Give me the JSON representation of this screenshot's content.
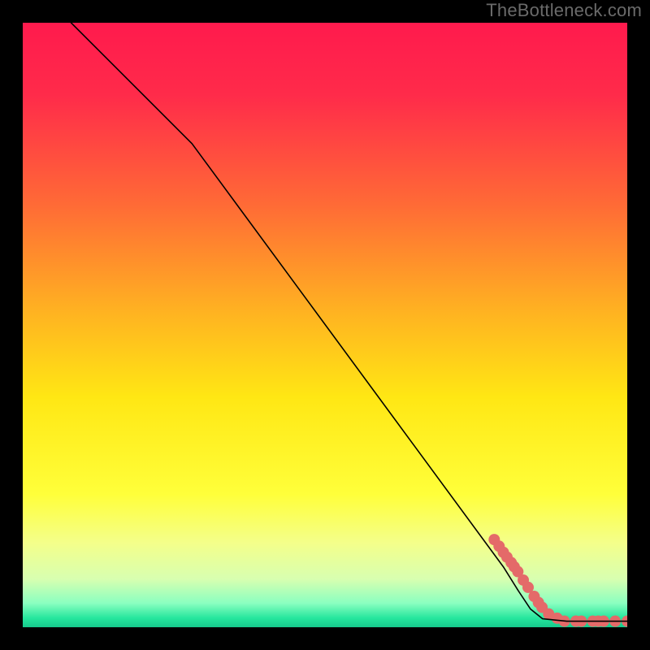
{
  "watermark": "TheBottleneck.com",
  "chart_data": {
    "type": "line",
    "title": "",
    "xlabel": "",
    "ylabel": "",
    "xlim": [
      0,
      100
    ],
    "ylim": [
      0,
      100
    ],
    "grid": false,
    "legend": false,
    "background_gradient": {
      "stops": [
        {
          "pos": 0.0,
          "color": "#ff1a4d"
        },
        {
          "pos": 0.12,
          "color": "#ff2b4a"
        },
        {
          "pos": 0.3,
          "color": "#ff6a36"
        },
        {
          "pos": 0.48,
          "color": "#ffb321"
        },
        {
          "pos": 0.62,
          "color": "#ffe714"
        },
        {
          "pos": 0.78,
          "color": "#ffff3a"
        },
        {
          "pos": 0.86,
          "color": "#f4ff8a"
        },
        {
          "pos": 0.92,
          "color": "#d8ffb0"
        },
        {
          "pos": 0.96,
          "color": "#8bffc0"
        },
        {
          "pos": 0.985,
          "color": "#25e69d"
        },
        {
          "pos": 1.0,
          "color": "#16c98c"
        }
      ]
    },
    "series": [
      {
        "name": "curve",
        "type": "line",
        "color": "#000000",
        "stroke_width": 1.6,
        "points": [
          {
            "x": 8.0,
            "y": 100.0
          },
          {
            "x": 28.0,
            "y": 80.0
          },
          {
            "x": 79.5,
            "y": 10.0
          },
          {
            "x": 82.0,
            "y": 6.0
          },
          {
            "x": 84.0,
            "y": 3.0
          },
          {
            "x": 86.0,
            "y": 1.4
          },
          {
            "x": 90.0,
            "y": 1.0
          },
          {
            "x": 100.0,
            "y": 1.0
          }
        ]
      },
      {
        "name": "markers",
        "type": "scatter",
        "color": "#e46a69",
        "radius": 7,
        "points": [
          {
            "x": 78.0,
            "y": 14.5
          },
          {
            "x": 78.8,
            "y": 13.4
          },
          {
            "x": 79.5,
            "y": 12.4
          },
          {
            "x": 80.1,
            "y": 11.6
          },
          {
            "x": 80.8,
            "y": 10.7
          },
          {
            "x": 81.3,
            "y": 10.0
          },
          {
            "x": 81.9,
            "y": 9.2
          },
          {
            "x": 82.8,
            "y": 7.8
          },
          {
            "x": 83.6,
            "y": 6.6
          },
          {
            "x": 84.6,
            "y": 5.1
          },
          {
            "x": 85.3,
            "y": 4.1
          },
          {
            "x": 85.9,
            "y": 3.3
          },
          {
            "x": 87.0,
            "y": 2.2
          },
          {
            "x": 88.4,
            "y": 1.5
          },
          {
            "x": 89.6,
            "y": 1.0
          },
          {
            "x": 91.5,
            "y": 1.0
          },
          {
            "x": 92.4,
            "y": 1.0
          },
          {
            "x": 94.3,
            "y": 1.0
          },
          {
            "x": 95.2,
            "y": 1.0
          },
          {
            "x": 96.1,
            "y": 1.0
          },
          {
            "x": 98.0,
            "y": 1.0
          },
          {
            "x": 100.0,
            "y": 1.0
          }
        ]
      }
    ]
  }
}
